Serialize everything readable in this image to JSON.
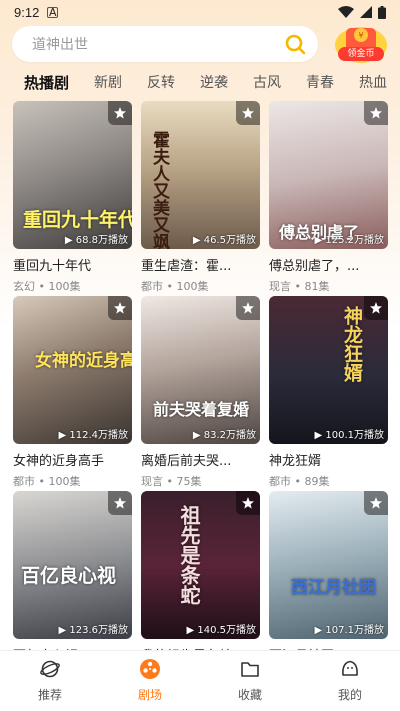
{
  "status_bar": {
    "time": "9:12",
    "app_badge": "A"
  },
  "search": {
    "placeholder": "道神出世"
  },
  "coin_button": {
    "label": "领金币"
  },
  "tabs": [
    {
      "label": "热播剧",
      "active": true
    },
    {
      "label": "新剧"
    },
    {
      "label": "反转"
    },
    {
      "label": "逆袭"
    },
    {
      "label": "古风"
    },
    {
      "label": "青春"
    },
    {
      "label": "热血"
    }
  ],
  "cards": [
    {
      "title": "重回九十年代",
      "meta": "玄幻 • 100集",
      "plays": "▶ 68.8万播放",
      "poster_text": "重回九十年代"
    },
    {
      "title": "重生虐渣：霍...",
      "meta": "都市 • 100集",
      "plays": "▶ 46.5万播放",
      "poster_text": "霍夫人又美又飒"
    },
    {
      "title": "傅总别虐了，...",
      "meta": "现言 • 81集",
      "plays": "▶ 125.2万播放",
      "poster_text": "傅总别虐了"
    },
    {
      "title": "女神的近身高手",
      "meta": "都市 • 100集",
      "plays": "▶ 112.4万播放",
      "poster_text": "女神的近身高手"
    },
    {
      "title": "离婚后前夫哭...",
      "meta": "现言 • 75集",
      "plays": "▶ 83.2万播放",
      "poster_text": "前夫哭着复婚"
    },
    {
      "title": "神龙狂婿",
      "meta": "都市 • 89集",
      "plays": "▶ 100.1万播放",
      "poster_text": "神龙狂婿"
    },
    {
      "title": "百亿良心视",
      "meta": "",
      "plays": "▶ 123.6万播放",
      "poster_text": "百亿良心视"
    },
    {
      "title": "我的祖先是条蛇",
      "meta": "",
      "plays": "▶ 140.5万播放",
      "poster_text": "祖先是条蛇"
    },
    {
      "title": "西江月社团",
      "meta": "",
      "plays": "▶ 107.1万播放",
      "poster_text": "西江月社团"
    }
  ],
  "bottom_nav": [
    {
      "label": "推荐",
      "icon": "planet-icon"
    },
    {
      "label": "剧场",
      "icon": "film-reel-icon",
      "active": true
    },
    {
      "label": "收藏",
      "icon": "folder-icon"
    },
    {
      "label": "我的",
      "icon": "profile-icon"
    }
  ],
  "colors": {
    "accent": "#ff7a1a",
    "search_icon": "#f5b800",
    "coin_red": "#ff3b2f"
  }
}
